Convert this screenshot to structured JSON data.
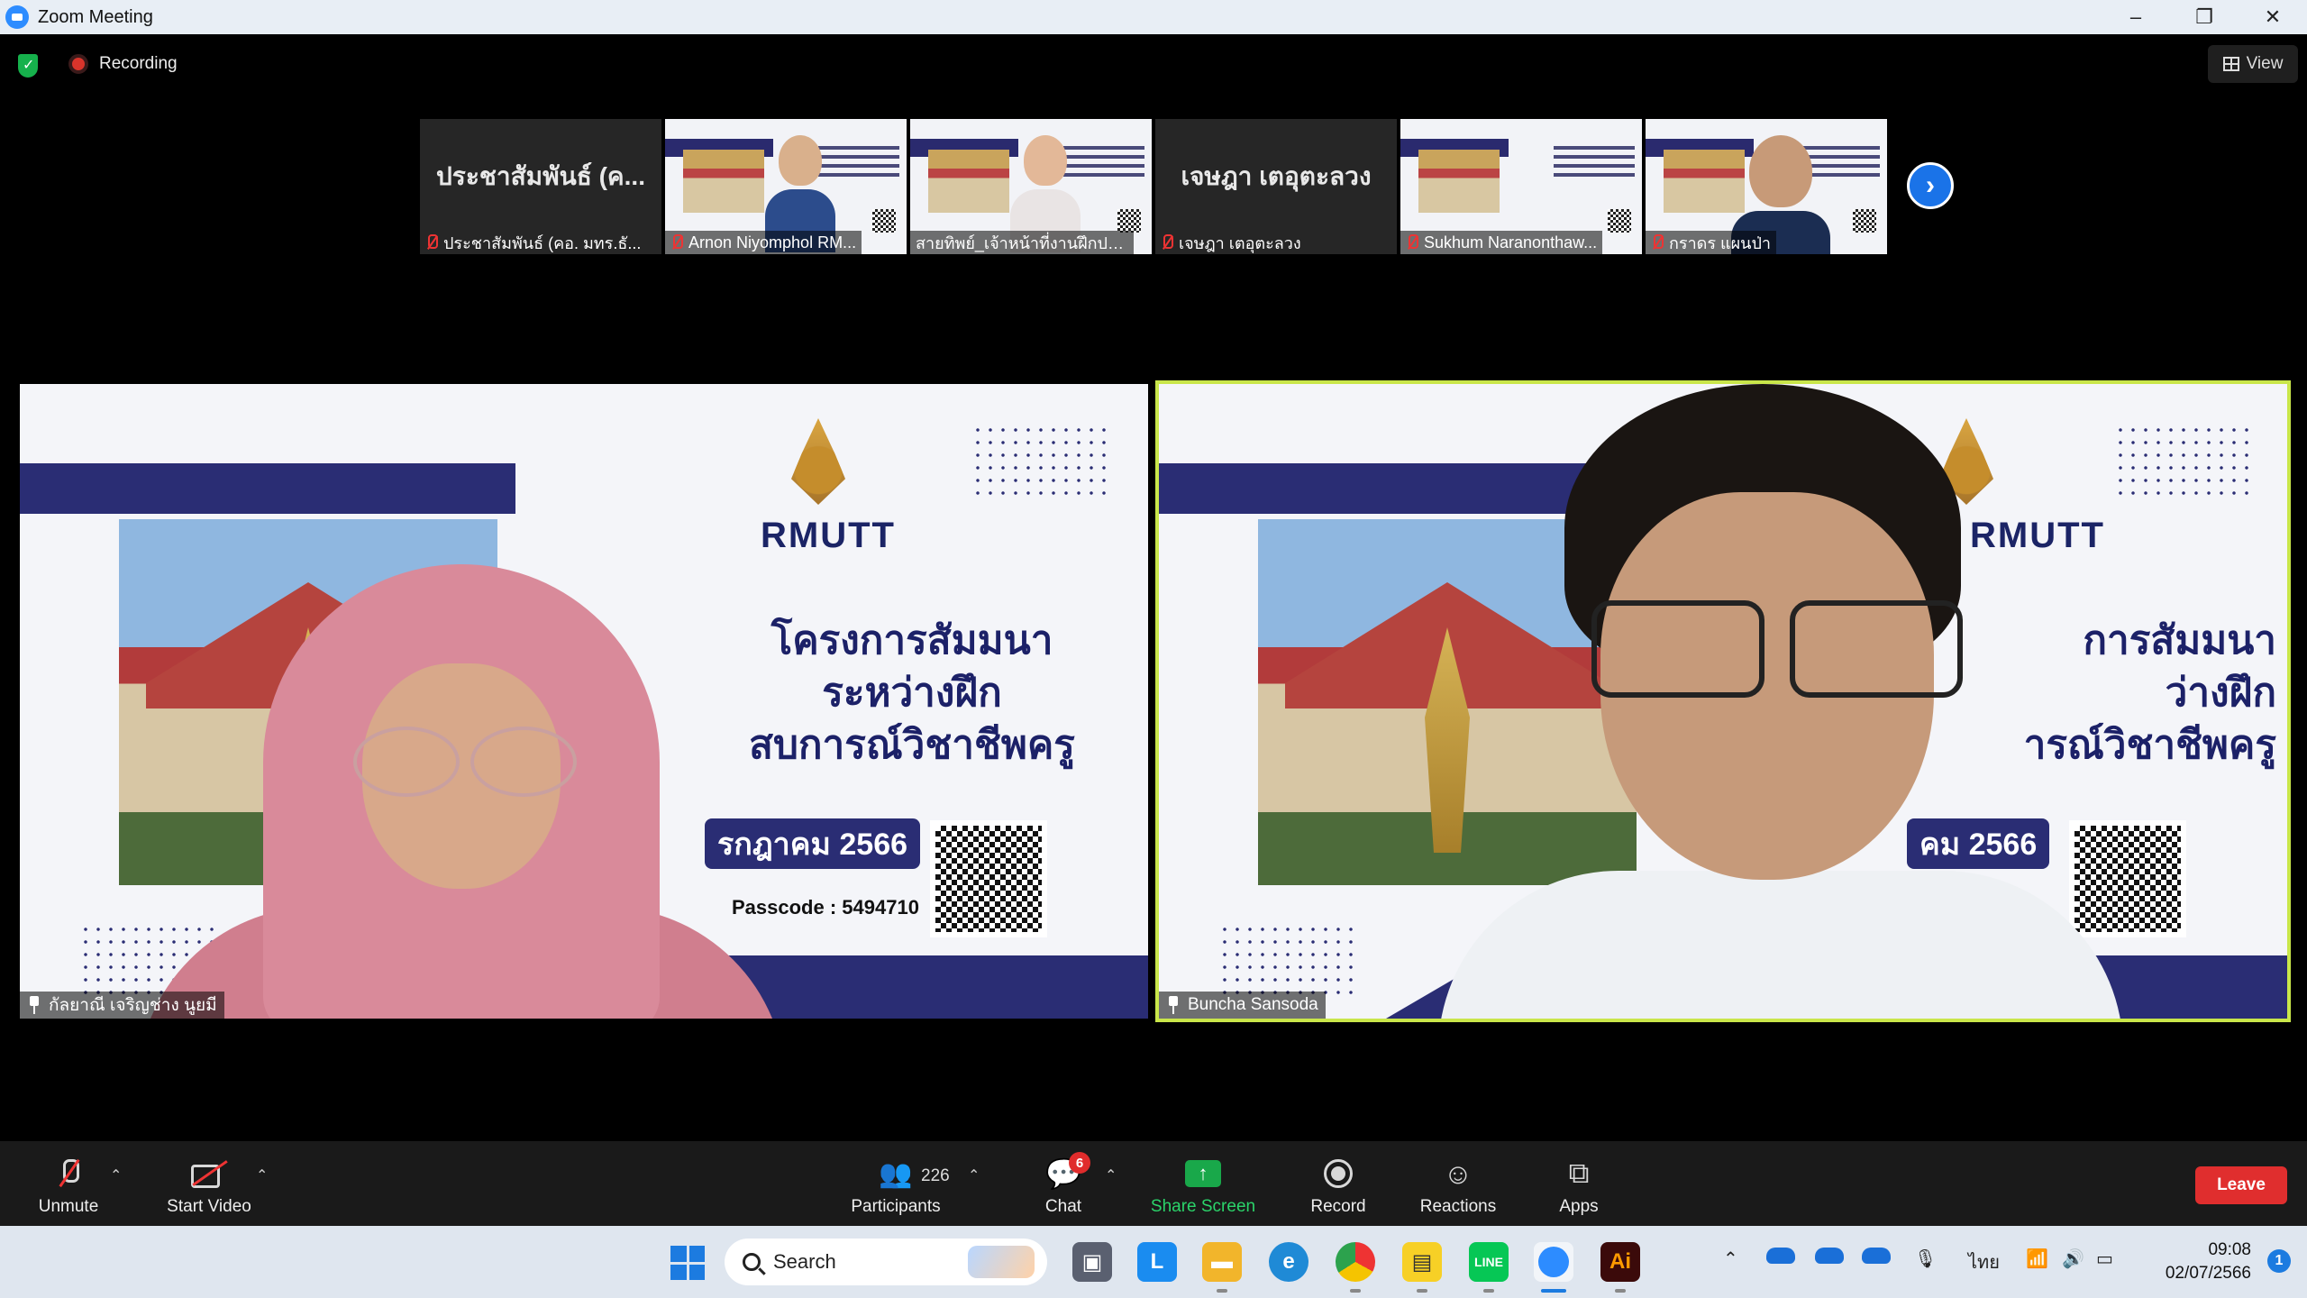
{
  "window": {
    "title": "Zoom Meeting",
    "controls": [
      "–",
      "❐",
      "✕"
    ]
  },
  "meeting": {
    "recording_label": "Recording",
    "view_label": "View"
  },
  "thumbnails": [
    {
      "display_text": "ประชาสัมพันธ์ (ค...",
      "caption": "ประชาสัมพันธ์ (คอ. มทร.ธั...",
      "kind": "name"
    },
    {
      "caption": "Arnon Niyomphol RM...",
      "kind": "video"
    },
    {
      "caption": "สายทิพย์_เจ้าหน้าที่งานฝึกประ...",
      "kind": "video"
    },
    {
      "display_text": "เจษฎา เตอุตะลวง",
      "caption": "เจษฎา เตอุตะลวง",
      "kind": "name"
    },
    {
      "caption": "Sukhum Naranonthaw...",
      "kind": "video"
    },
    {
      "caption": "กราดร แผนป่า",
      "kind": "video"
    }
  ],
  "slide": {
    "logo": "RMUTT",
    "title_lines": [
      "โครงการสัมมนา",
      "ระหว่างฝึก",
      "ประสบการณ์วิชาชีพครู"
    ],
    "date_text": "กรกฎาคม 2566",
    "passcode_text": "Passcode : 5494710"
  },
  "left_tile": {
    "slide_title_lines": [
      "โครงการสัมมนา",
      "ระหว่างฝึก",
      "สบการณ์วิชาชีพครู"
    ],
    "slide_date": "รกฎาคม 2566",
    "passcode": "Passcode : 5494710",
    "name": "กัลยาณี เจริญช่าง นูยมี"
  },
  "right_tile": {
    "slide_title_lines": [
      "การสัมมนา",
      "ว่างฝึก",
      "ารณ์วิชาชีพครู"
    ],
    "slide_date": "คม 2566",
    "name": "Buncha Sansoda",
    "active_speaker_color": "#c9e64a"
  },
  "toolbar": {
    "unmute": "Unmute",
    "start_video": "Start Video",
    "participants": "Participants",
    "participants_count": "226",
    "chat": "Chat",
    "chat_badge": "6",
    "share_screen": "Share Screen",
    "record": "Record",
    "reactions": "Reactions",
    "apps": "Apps",
    "leave": "Leave"
  },
  "taskbar": {
    "search_placeholder": "Search",
    "language": "ไทย",
    "time": "09:08",
    "date": "02/07/2566",
    "notification_count": "1"
  }
}
